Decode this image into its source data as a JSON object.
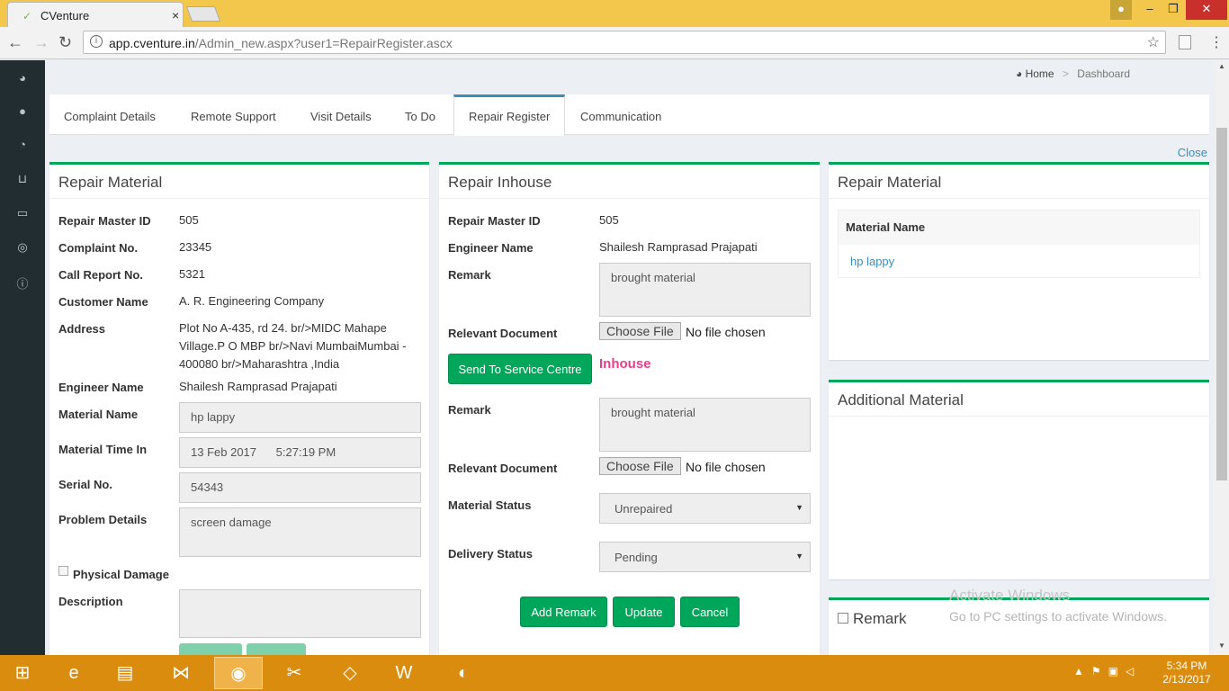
{
  "browser": {
    "tab_title": "CVenture",
    "tab_close": "×",
    "url_host": "app.cventure.in",
    "url_path": "/Admin_new.aspx?user1=RepairRegister.ascx"
  },
  "breadcrumb": {
    "home": "Home",
    "separator": ">",
    "current": "Dashboard"
  },
  "tabs": [
    {
      "label": "Complaint Details"
    },
    {
      "label": "Remote Support"
    },
    {
      "label": "Visit Details"
    },
    {
      "label": "To Do"
    },
    {
      "label": "Repair Register",
      "active": true
    },
    {
      "label": "Communication"
    }
  ],
  "close_link": "Close",
  "repair_material": {
    "title": "Repair Material",
    "repair_master_id_label": "Repair Master ID",
    "repair_master_id": "505",
    "complaint_no_label": "Complaint No.",
    "complaint_no": "23345",
    "call_report_no_label": "Call Report No.",
    "call_report_no": "5321",
    "customer_name_label": "Customer Name",
    "customer_name": "A. R. Engineering Company",
    "address_label": "Address",
    "address": "Plot No A-435, rd 24. br/>MIDC Mahape Village.P O MBP br/>Navi MumbaiMumbai - 400080 br/>Maharashtra ,India",
    "engineer_name_label": "Engineer Name",
    "engineer_name": "Shailesh Ramprasad Prajapati",
    "material_name_label": "Material Name",
    "material_name": "hp lappy",
    "material_time_in_label": "Material Time In",
    "material_time_in": "13 Feb 2017      5:27:19 PM",
    "serial_no_label": "Serial No.",
    "serial_no": "54343",
    "problem_details_label": "Problem Details",
    "problem_details": "screen damage",
    "physical_damage_label": "Physical Damage",
    "description_label": "Description",
    "description": ""
  },
  "repair_inhouse": {
    "title": "Repair Inhouse",
    "repair_master_id_label": "Repair Master ID",
    "repair_master_id": "505",
    "engineer_name_label": "Engineer Name",
    "engineer_name": "Shailesh Ramprasad Prajapati",
    "remark_label": "Remark",
    "remark1": "brought material",
    "relevant_doc_label": "Relevant Document",
    "choose_file": "Choose File",
    "no_file": "No file chosen",
    "send_button": "Send To Service Centre",
    "status_text": "Inhouse",
    "status_color": "#e83e8c",
    "remark2": "brought material",
    "material_status_label": "Material Status",
    "material_status": "Unrepaired",
    "delivery_status_label": "Delivery Status",
    "delivery_status": "Pending",
    "add_remark_button": "Add Remark",
    "update_button": "Update",
    "cancel_button": "Cancel"
  },
  "material_panel": {
    "title": "Repair Material",
    "column_header": "Material Name",
    "rows": [
      "hp lappy"
    ]
  },
  "additional_panel": {
    "title": "Additional Material"
  },
  "remark_panel": {
    "title": "Remark"
  },
  "watermark": {
    "line1": "Activate Windows",
    "line2": "Go to PC settings to activate Windows."
  },
  "taskbar": {
    "time": "5:34 PM",
    "date": "2/13/2017"
  },
  "colors": {
    "accent": "#00a65a",
    "link": "#3c8dbc",
    "sidebar": "#222d32",
    "taskbar": "#d98c0e"
  }
}
